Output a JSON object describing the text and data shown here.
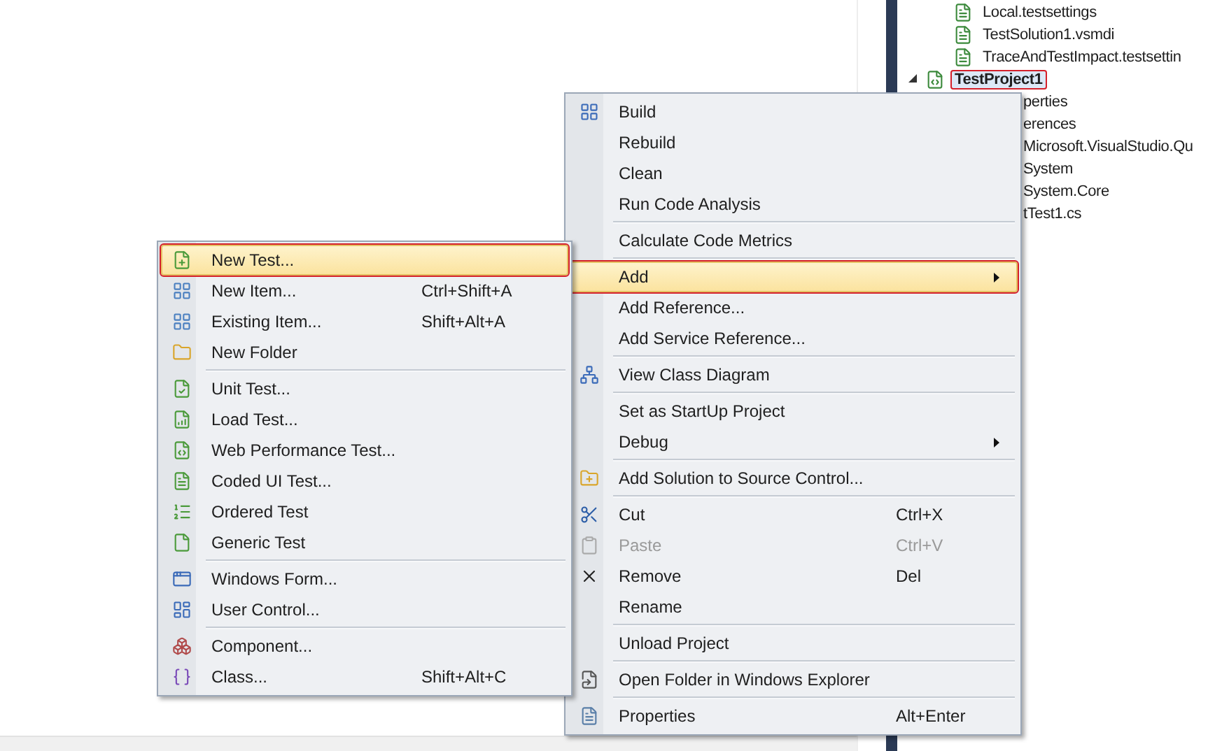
{
  "solution_explorer": {
    "items": [
      {
        "label": "Local.testsettings",
        "selected": false,
        "outlined": false
      },
      {
        "label": "TestSolution1.vsmdi",
        "selected": false,
        "outlined": false
      },
      {
        "label": "TraceAndTestImpact.testsettin",
        "selected": false,
        "outlined": false
      },
      {
        "label": "TestProject1",
        "selected": true,
        "outlined": true,
        "expanded": true,
        "children": [
          {
            "label": "perties"
          },
          {
            "label": "erences"
          },
          {
            "label": "Microsoft.VisualStudio.Qu"
          },
          {
            "label": "System"
          },
          {
            "label": "System.Core"
          },
          {
            "label": "tTest1.cs"
          }
        ]
      }
    ]
  },
  "context_menu": {
    "items": [
      {
        "kind": "item",
        "label": "Build",
        "selected": false,
        "outlined": false,
        "disabled": false,
        "submenu": false
      },
      {
        "kind": "item",
        "label": "Rebuild",
        "selected": false,
        "outlined": false,
        "disabled": false,
        "submenu": false
      },
      {
        "kind": "item",
        "label": "Clean",
        "selected": false,
        "outlined": false,
        "disabled": false,
        "submenu": false
      },
      {
        "kind": "item",
        "label": "Run Code Analysis",
        "selected": false,
        "outlined": false,
        "disabled": false,
        "submenu": false
      },
      {
        "kind": "separator"
      },
      {
        "kind": "item",
        "label": "Calculate Code Metrics",
        "selected": false,
        "outlined": false,
        "disabled": false,
        "submenu": false
      },
      {
        "kind": "separator"
      },
      {
        "kind": "item",
        "label": "Add",
        "selected": true,
        "outlined": true,
        "disabled": false,
        "submenu": true
      },
      {
        "kind": "item",
        "label": "Add Reference...",
        "selected": false,
        "outlined": false,
        "disabled": false,
        "submenu": false
      },
      {
        "kind": "item",
        "label": "Add Service Reference...",
        "selected": false,
        "outlined": false,
        "disabled": false,
        "submenu": false
      },
      {
        "kind": "separator"
      },
      {
        "kind": "item",
        "label": "View Class Diagram",
        "selected": false,
        "outlined": false,
        "disabled": false,
        "submenu": false
      },
      {
        "kind": "separator"
      },
      {
        "kind": "item",
        "label": "Set as StartUp Project",
        "selected": false,
        "outlined": false,
        "disabled": false,
        "submenu": false
      },
      {
        "kind": "item",
        "label": "Debug",
        "selected": false,
        "outlined": false,
        "disabled": false,
        "submenu": true
      },
      {
        "kind": "separator"
      },
      {
        "kind": "item",
        "label": "Add Solution to Source Control...",
        "selected": false,
        "outlined": false,
        "disabled": false,
        "submenu": false
      },
      {
        "kind": "separator"
      },
      {
        "kind": "item",
        "label": "Cut",
        "shortcut": "Ctrl+X",
        "selected": false,
        "outlined": false,
        "disabled": false,
        "submenu": false
      },
      {
        "kind": "item",
        "label": "Paste",
        "shortcut": "Ctrl+V",
        "selected": false,
        "outlined": false,
        "disabled": true,
        "submenu": false
      },
      {
        "kind": "item",
        "label": "Remove",
        "shortcut": "Del",
        "selected": false,
        "outlined": false,
        "disabled": false,
        "submenu": false
      },
      {
        "kind": "item",
        "label": "Rename",
        "selected": false,
        "outlined": false,
        "disabled": false,
        "submenu": false
      },
      {
        "kind": "separator"
      },
      {
        "kind": "item",
        "label": "Unload Project",
        "selected": false,
        "outlined": false,
        "disabled": false,
        "submenu": false
      },
      {
        "kind": "separator"
      },
      {
        "kind": "item",
        "label": "Open Folder in Windows Explorer",
        "selected": false,
        "outlined": false,
        "disabled": false,
        "submenu": false
      },
      {
        "kind": "separator"
      },
      {
        "kind": "item",
        "label": "Properties",
        "shortcut": "Alt+Enter",
        "selected": false,
        "outlined": false,
        "disabled": false,
        "submenu": false
      }
    ]
  },
  "add_submenu": {
    "items": [
      {
        "kind": "item",
        "label": "New Test...",
        "selected": true,
        "outlined": true
      },
      {
        "kind": "item",
        "label": "New Item...",
        "shortcut": "Ctrl+Shift+A",
        "selected": false,
        "outlined": false
      },
      {
        "kind": "item",
        "label": "Existing Item...",
        "shortcut": "Shift+Alt+A",
        "selected": false,
        "outlined": false
      },
      {
        "kind": "item",
        "label": "New Folder",
        "selected": false,
        "outlined": false
      },
      {
        "kind": "separator"
      },
      {
        "kind": "item",
        "label": "Unit Test...",
        "selected": false,
        "outlined": false
      },
      {
        "kind": "item",
        "label": "Load Test...",
        "selected": false,
        "outlined": false
      },
      {
        "kind": "item",
        "label": "Web Performance Test...",
        "selected": false,
        "outlined": false
      },
      {
        "kind": "item",
        "label": "Coded UI Test...",
        "selected": false,
        "outlined": false
      },
      {
        "kind": "item",
        "label": "Ordered Test",
        "selected": false,
        "outlined": false
      },
      {
        "kind": "item",
        "label": "Generic Test",
        "selected": false,
        "outlined": false
      },
      {
        "kind": "separator"
      },
      {
        "kind": "item",
        "label": "Windows Form...",
        "selected": false,
        "outlined": false
      },
      {
        "kind": "item",
        "label": "User Control...",
        "selected": false,
        "outlined": false
      },
      {
        "kind": "separator"
      },
      {
        "kind": "item",
        "label": "Component...",
        "selected": false,
        "outlined": false
      },
      {
        "kind": "item",
        "label": "Class...",
        "shortcut": "Shift+Alt+C",
        "selected": false,
        "outlined": false
      }
    ]
  }
}
